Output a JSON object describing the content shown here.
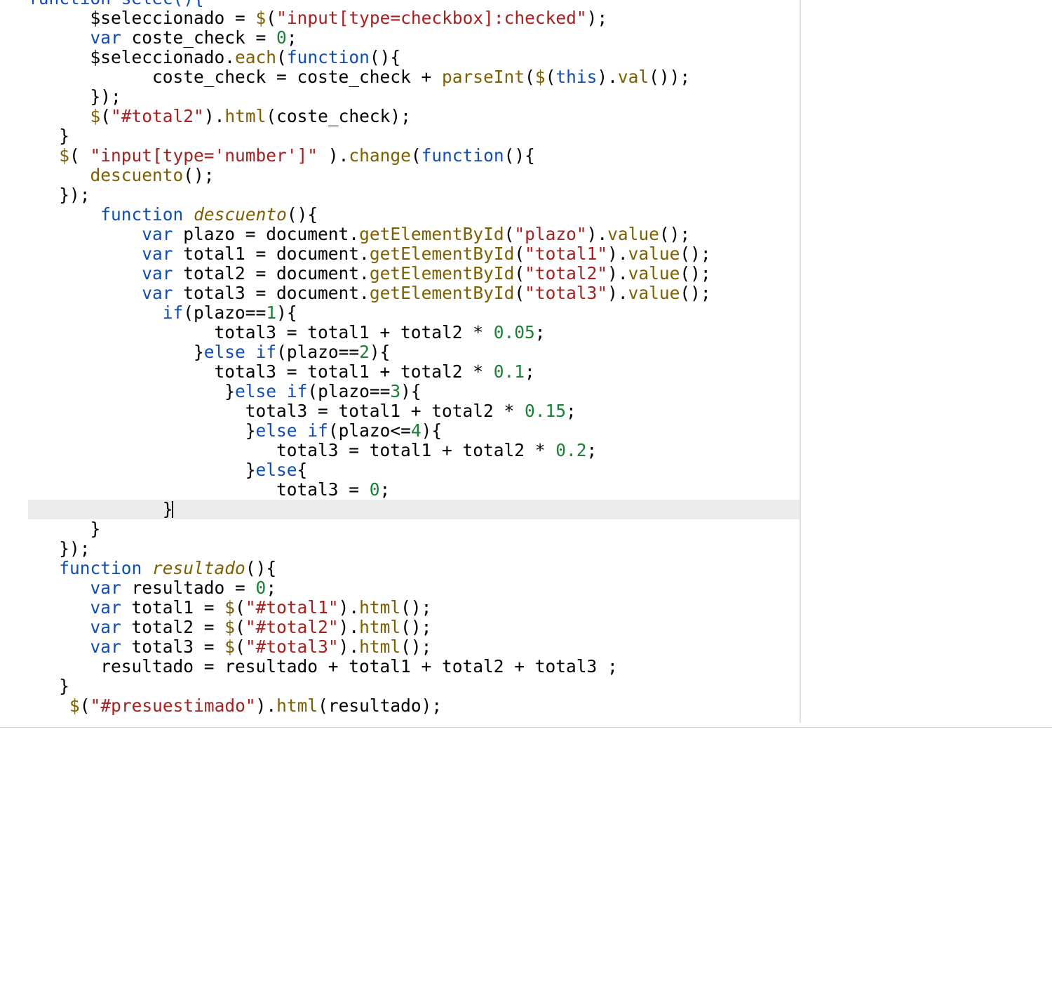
{
  "editor": {
    "highlighted_line_index": 25,
    "lines": [
      {
        "indent": 0,
        "tokens": [
          {
            "t": "function",
            "c": "truncated"
          },
          {
            "t": " ",
            "c": ""
          },
          {
            "t": "selec",
            "c": "truncated"
          },
          {
            "t": "(){",
            "c": "tok-op truncated"
          }
        ]
      },
      {
        "indent": 2,
        "tokens": [
          {
            "t": "$seleccionado = ",
            "c": "tok-var"
          },
          {
            "t": "$",
            "c": "tok-fn"
          },
          {
            "t": "(",
            "c": "tok-op"
          },
          {
            "t": "\"input[type=checkbox]:checked\"",
            "c": "tok-str"
          },
          {
            "t": ");",
            "c": "tok-op"
          }
        ]
      },
      {
        "indent": 2,
        "tokens": [
          {
            "t": "var",
            "c": "tok-kw"
          },
          {
            "t": " coste_check = ",
            "c": "tok-var"
          },
          {
            "t": "0",
            "c": "tok-num"
          },
          {
            "t": ";",
            "c": "tok-op"
          }
        ]
      },
      {
        "indent": 2,
        "tokens": [
          {
            "t": "$seleccionado.",
            "c": "tok-var"
          },
          {
            "t": "each",
            "c": "tok-fn"
          },
          {
            "t": "(",
            "c": "tok-op"
          },
          {
            "t": "function",
            "c": "tok-kw"
          },
          {
            "t": "(){",
            "c": "tok-op"
          }
        ]
      },
      {
        "indent": 3,
        "tokens": [
          {
            "t": "   coste_check = coste_check + ",
            "c": "tok-var"
          },
          {
            "t": "parseInt",
            "c": "tok-fn"
          },
          {
            "t": "(",
            "c": "tok-op"
          },
          {
            "t": "$",
            "c": "tok-fn"
          },
          {
            "t": "(",
            "c": "tok-op"
          },
          {
            "t": "this",
            "c": "tok-kw"
          },
          {
            "t": ").",
            "c": "tok-op"
          },
          {
            "t": "val",
            "c": "tok-fn"
          },
          {
            "t": "());",
            "c": "tok-op"
          }
        ]
      },
      {
        "indent": 2,
        "tokens": [
          {
            "t": "});",
            "c": "tok-op"
          }
        ]
      },
      {
        "indent": 2,
        "tokens": [
          {
            "t": "$",
            "c": "tok-fn"
          },
          {
            "t": "(",
            "c": "tok-op"
          },
          {
            "t": "\"#total2\"",
            "c": "tok-str"
          },
          {
            "t": ").",
            "c": "tok-op"
          },
          {
            "t": "html",
            "c": "tok-fn"
          },
          {
            "t": "(coste_check);",
            "c": "tok-op"
          }
        ]
      },
      {
        "indent": 1,
        "tokens": [
          {
            "t": "}",
            "c": "tok-op"
          }
        ]
      },
      {
        "indent": 1,
        "tokens": [
          {
            "t": "$",
            "c": "tok-fn"
          },
          {
            "t": "( ",
            "c": "tok-op"
          },
          {
            "t": "\"input[type='number']\"",
            "c": "tok-str"
          },
          {
            "t": " ).",
            "c": "tok-op"
          },
          {
            "t": "change",
            "c": "tok-fn"
          },
          {
            "t": "(",
            "c": "tok-op"
          },
          {
            "t": "function",
            "c": "tok-kw"
          },
          {
            "t": "(){",
            "c": "tok-op"
          }
        ]
      },
      {
        "indent": 2,
        "tokens": [
          {
            "t": "descuento",
            "c": "tok-fn"
          },
          {
            "t": "();",
            "c": "tok-op"
          }
        ]
      },
      {
        "indent": 1,
        "tokens": [
          {
            "t": "});",
            "c": "tok-op"
          }
        ]
      },
      {
        "indent": 2,
        "tokens": [
          {
            "t": " ",
            "c": ""
          },
          {
            "t": "function",
            "c": "tok-kw"
          },
          {
            "t": " ",
            "c": ""
          },
          {
            "t": "descuento",
            "c": "tok-fndef"
          },
          {
            "t": "(){",
            "c": "tok-op"
          }
        ]
      },
      {
        "indent": 3,
        "tokens": [
          {
            "t": "  ",
            "c": ""
          },
          {
            "t": "var",
            "c": "tok-kw"
          },
          {
            "t": " plazo = document.",
            "c": "tok-var"
          },
          {
            "t": "getElementById",
            "c": "tok-fn"
          },
          {
            "t": "(",
            "c": "tok-op"
          },
          {
            "t": "\"plazo\"",
            "c": "tok-str"
          },
          {
            "t": ").",
            "c": "tok-op"
          },
          {
            "t": "value",
            "c": "tok-fn"
          },
          {
            "t": "();",
            "c": "tok-op"
          }
        ]
      },
      {
        "indent": 3,
        "tokens": [
          {
            "t": "  ",
            "c": ""
          },
          {
            "t": "var",
            "c": "tok-kw"
          },
          {
            "t": " total1 = document.",
            "c": "tok-var"
          },
          {
            "t": "getElementById",
            "c": "tok-fn"
          },
          {
            "t": "(",
            "c": "tok-op"
          },
          {
            "t": "\"total1\"",
            "c": "tok-str"
          },
          {
            "t": ").",
            "c": "tok-op"
          },
          {
            "t": "value",
            "c": "tok-fn"
          },
          {
            "t": "();",
            "c": "tok-op"
          }
        ]
      },
      {
        "indent": 3,
        "tokens": [
          {
            "t": "  ",
            "c": ""
          },
          {
            "t": "var",
            "c": "tok-kw"
          },
          {
            "t": " total2 = document.",
            "c": "tok-var"
          },
          {
            "t": "getElementById",
            "c": "tok-fn"
          },
          {
            "t": "(",
            "c": "tok-op"
          },
          {
            "t": "\"total2\"",
            "c": "tok-str"
          },
          {
            "t": ").",
            "c": "tok-op"
          },
          {
            "t": "value",
            "c": "tok-fn"
          },
          {
            "t": "();",
            "c": "tok-op"
          }
        ]
      },
      {
        "indent": 3,
        "tokens": [
          {
            "t": "  ",
            "c": ""
          },
          {
            "t": "var",
            "c": "tok-kw"
          },
          {
            "t": " total3 = document.",
            "c": "tok-var"
          },
          {
            "t": "getElementById",
            "c": "tok-fn"
          },
          {
            "t": "(",
            "c": "tok-op"
          },
          {
            "t": "\"total3\"",
            "c": "tok-str"
          },
          {
            "t": ").",
            "c": "tok-op"
          },
          {
            "t": "value",
            "c": "tok-fn"
          },
          {
            "t": "();",
            "c": "tok-op"
          }
        ]
      },
      {
        "indent": 4,
        "tokens": [
          {
            "t": " ",
            "c": ""
          },
          {
            "t": "if",
            "c": "tok-kw"
          },
          {
            "t": "(plazo==",
            "c": "tok-op"
          },
          {
            "t": "1",
            "c": "tok-num"
          },
          {
            "t": "){",
            "c": "tok-op"
          }
        ]
      },
      {
        "indent": 6,
        "tokens": [
          {
            "t": "total3 = total1 + total2 * ",
            "c": "tok-var"
          },
          {
            "t": "0.05",
            "c": "tok-num"
          },
          {
            "t": ";",
            "c": "tok-op"
          }
        ]
      },
      {
        "indent": 5,
        "tokens": [
          {
            "t": " }",
            "c": "tok-op"
          },
          {
            "t": "else",
            "c": "tok-kw"
          },
          {
            "t": " ",
            "c": ""
          },
          {
            "t": "if",
            "c": "tok-kw"
          },
          {
            "t": "(plazo==",
            "c": "tok-op"
          },
          {
            "t": "2",
            "c": "tok-num"
          },
          {
            "t": "){",
            "c": "tok-op"
          }
        ]
      },
      {
        "indent": 6,
        "tokens": [
          {
            "t": "total3 = total1 + total2 * ",
            "c": "tok-var"
          },
          {
            "t": "0.1",
            "c": "tok-num"
          },
          {
            "t": ";",
            "c": "tok-op"
          }
        ]
      },
      {
        "indent": 6,
        "tokens": [
          {
            "t": " }",
            "c": "tok-op"
          },
          {
            "t": "else",
            "c": "tok-kw"
          },
          {
            "t": " ",
            "c": ""
          },
          {
            "t": "if",
            "c": "tok-kw"
          },
          {
            "t": "(plazo==",
            "c": "tok-op"
          },
          {
            "t": "3",
            "c": "tok-num"
          },
          {
            "t": "){",
            "c": "tok-op"
          }
        ]
      },
      {
        "indent": 7,
        "tokens": [
          {
            "t": "total3 = total1 + total2 * ",
            "c": "tok-var"
          },
          {
            "t": "0.15",
            "c": "tok-num"
          },
          {
            "t": ";",
            "c": "tok-op"
          }
        ]
      },
      {
        "indent": 7,
        "tokens": [
          {
            "t": "}",
            "c": "tok-op"
          },
          {
            "t": "else",
            "c": "tok-kw"
          },
          {
            "t": " ",
            "c": ""
          },
          {
            "t": "if",
            "c": "tok-kw"
          },
          {
            "t": "(plazo<=",
            "c": "tok-op"
          },
          {
            "t": "4",
            "c": "tok-num"
          },
          {
            "t": "){",
            "c": "tok-op"
          }
        ]
      },
      {
        "indent": 8,
        "tokens": [
          {
            "t": "total3 = total1 + total2 * ",
            "c": "tok-var"
          },
          {
            "t": "0.2",
            "c": "tok-num"
          },
          {
            "t": ";",
            "c": "tok-op"
          }
        ]
      },
      {
        "indent": 7,
        "tokens": [
          {
            "t": "}",
            "c": "tok-op"
          },
          {
            "t": "else",
            "c": "tok-kw"
          },
          {
            "t": "{",
            "c": "tok-op"
          }
        ]
      },
      {
        "indent": 8,
        "tokens": [
          {
            "t": "total3 = ",
            "c": "tok-var"
          },
          {
            "t": "0",
            "c": "tok-num"
          },
          {
            "t": ";",
            "c": "tok-op"
          }
        ]
      },
      {
        "indent": 4,
        "highlighted": true,
        "tokens": [
          {
            "t": " }",
            "c": "tok-op"
          },
          {
            "t": "",
            "c": "caret-marker"
          }
        ]
      },
      {
        "indent": 2,
        "tokens": [
          {
            "t": "}",
            "c": "tok-op"
          }
        ]
      },
      {
        "indent": 1,
        "tokens": [
          {
            "t": "});",
            "c": "tok-op"
          }
        ]
      },
      {
        "indent": 1,
        "tokens": [
          {
            "t": "function",
            "c": "tok-kw"
          },
          {
            "t": " ",
            "c": ""
          },
          {
            "t": "resultado",
            "c": "tok-fndef"
          },
          {
            "t": "(){",
            "c": "tok-op"
          }
        ]
      },
      {
        "indent": 2,
        "tokens": [
          {
            "t": "var",
            "c": "tok-kw"
          },
          {
            "t": " resultado = ",
            "c": "tok-var"
          },
          {
            "t": "0",
            "c": "tok-num"
          },
          {
            "t": ";",
            "c": "tok-op"
          }
        ]
      },
      {
        "indent": 2,
        "tokens": [
          {
            "t": "var",
            "c": "tok-kw"
          },
          {
            "t": " total1 = ",
            "c": "tok-var"
          },
          {
            "t": "$",
            "c": "tok-fn"
          },
          {
            "t": "(",
            "c": "tok-op"
          },
          {
            "t": "\"#total1\"",
            "c": "tok-str"
          },
          {
            "t": ").",
            "c": "tok-op"
          },
          {
            "t": "html",
            "c": "tok-fn"
          },
          {
            "t": "();",
            "c": "tok-op"
          }
        ]
      },
      {
        "indent": 2,
        "tokens": [
          {
            "t": "var",
            "c": "tok-kw"
          },
          {
            "t": " total2 = ",
            "c": "tok-var"
          },
          {
            "t": "$",
            "c": "tok-fn"
          },
          {
            "t": "(",
            "c": "tok-op"
          },
          {
            "t": "\"#total2\"",
            "c": "tok-str"
          },
          {
            "t": ").",
            "c": "tok-op"
          },
          {
            "t": "html",
            "c": "tok-fn"
          },
          {
            "t": "();",
            "c": "tok-op"
          }
        ]
      },
      {
        "indent": 2,
        "tokens": [
          {
            "t": "var",
            "c": "tok-kw"
          },
          {
            "t": " total3 = ",
            "c": "tok-var"
          },
          {
            "t": "$",
            "c": "tok-fn"
          },
          {
            "t": "(",
            "c": "tok-op"
          },
          {
            "t": "\"#total3\"",
            "c": "tok-str"
          },
          {
            "t": ").",
            "c": "tok-op"
          },
          {
            "t": "html",
            "c": "tok-fn"
          },
          {
            "t": "();",
            "c": "tok-op"
          }
        ]
      },
      {
        "indent": 2,
        "tokens": [
          {
            "t": " resultado = resultado + total1 + total2 + total3 ;",
            "c": "tok-var"
          }
        ]
      },
      {
        "indent": 1,
        "tokens": [
          {
            "t": "}",
            "c": "tok-op"
          }
        ]
      },
      {
        "indent": 1,
        "tokens": [
          {
            "t": " ",
            "c": ""
          },
          {
            "t": "$",
            "c": "tok-fn"
          },
          {
            "t": "(",
            "c": "tok-op"
          },
          {
            "t": "\"#presuestimado\"",
            "c": "tok-str"
          },
          {
            "t": ").",
            "c": "tok-op"
          },
          {
            "t": "html",
            "c": "tok-fn"
          },
          {
            "t": "(resultado);",
            "c": "tok-op"
          }
        ]
      }
    ]
  }
}
